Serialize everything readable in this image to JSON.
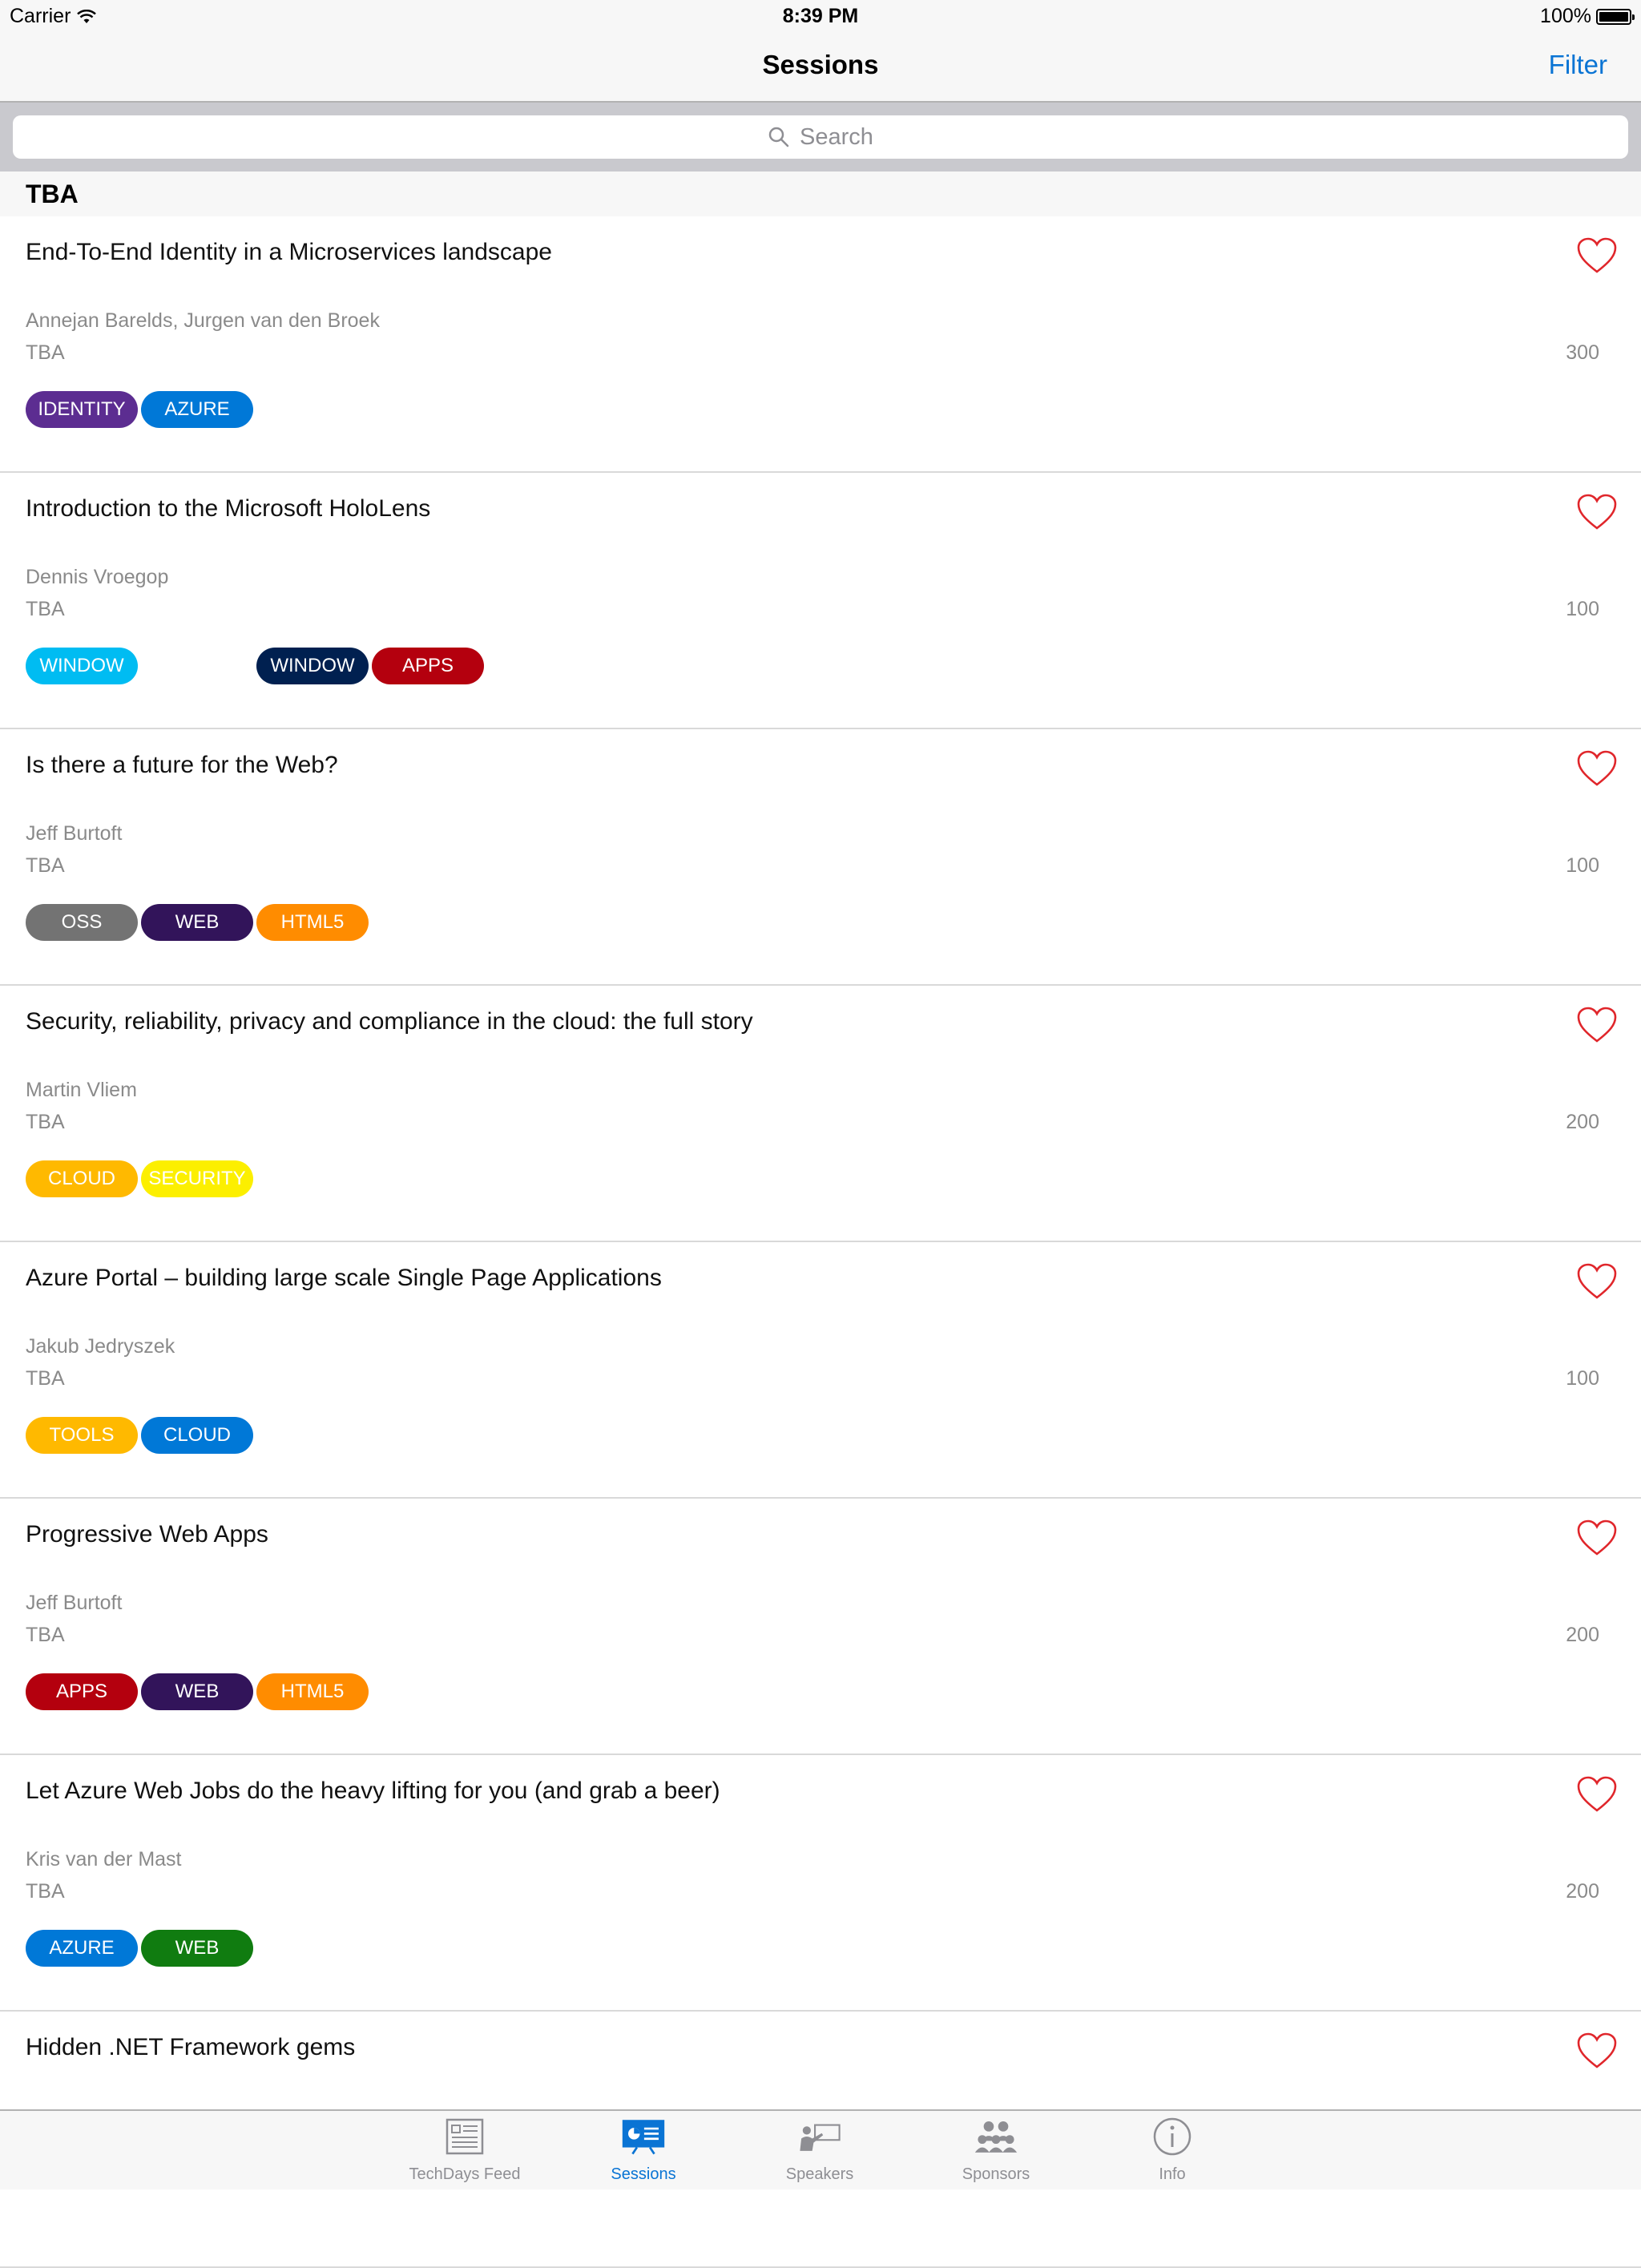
{
  "status_bar": {
    "carrier": "Carrier",
    "time": "8:39 PM",
    "battery": "100%"
  },
  "nav": {
    "title": "Sessions",
    "filter_label": "Filter"
  },
  "search": {
    "placeholder": "Search"
  },
  "section": {
    "title": "TBA"
  },
  "sessions": [
    {
      "title": "End-To-End Identity in a Microservices landscape",
      "speakers": "Annejan Barelds, Jurgen van den Broek",
      "room": "TBA",
      "level": "300",
      "tags": [
        {
          "label": "IDENTITY",
          "color": "#5c2d91"
        },
        {
          "label": "AZURE",
          "color": "#0078d7"
        }
      ]
    },
    {
      "title": "Introduction to the Microsoft HoloLens",
      "speakers": "Dennis Vroegop",
      "room": "TBA",
      "level": "100",
      "tags": [
        {
          "label": "WINDOW",
          "color": "#00bcf2"
        },
        {
          "label": "",
          "color": "transparent"
        },
        {
          "label": "WINDOW",
          "color": "#002050"
        },
        {
          "label": "APPS",
          "color": "#b4000e"
        }
      ]
    },
    {
      "title": "Is there a future for the Web?",
      "speakers": "Jeff Burtoft",
      "room": "TBA",
      "level": "100",
      "tags": [
        {
          "label": "OSS",
          "color": "#737373"
        },
        {
          "label": "WEB",
          "color": "#32145a"
        },
        {
          "label": "HTML5",
          "color": "#ff8c00"
        }
      ]
    },
    {
      "title": "Security, reliability, privacy and compliance in the cloud: the full story",
      "speakers": "Martin Vliem",
      "room": "TBA",
      "level": "200",
      "tags": [
        {
          "label": "CLOUD",
          "color": "#ffb900"
        },
        {
          "label": "SECURITY",
          "color": "#fcef00"
        }
      ]
    },
    {
      "title": "Azure Portal – building large scale Single Page Applications",
      "speakers": "Jakub Jedryszek",
      "room": "TBA",
      "level": "100",
      "tags": [
        {
          "label": "TOOLS",
          "color": "#ffb900"
        },
        {
          "label": "CLOUD",
          "color": "#0078d7"
        }
      ]
    },
    {
      "title": "Progressive Web Apps",
      "speakers": "Jeff Burtoft",
      "room": "TBA",
      "level": "200",
      "tags": [
        {
          "label": "APPS",
          "color": "#b4000e"
        },
        {
          "label": "WEB",
          "color": "#32145a"
        },
        {
          "label": "HTML5",
          "color": "#ff8c00"
        }
      ]
    },
    {
      "title": "Let Azure Web Jobs do the heavy lifting for you (and grab a beer)",
      "speakers": "Kris van der Mast",
      "room": "TBA",
      "level": "200",
      "tags": [
        {
          "label": "AZURE",
          "color": "#0078d7"
        },
        {
          "label": "WEB",
          "color": "#107c10"
        }
      ]
    },
    {
      "title": "Hidden .NET Framework gems",
      "speakers": "",
      "room": "",
      "level": "",
      "tags": []
    }
  ],
  "tabs": [
    {
      "label": "TechDays Feed",
      "icon": "newspaper-icon",
      "active": false
    },
    {
      "label": "Sessions",
      "icon": "presentation-icon",
      "active": true
    },
    {
      "label": "Speakers",
      "icon": "speaker-icon",
      "active": false
    },
    {
      "label": "Sponsors",
      "icon": "people-icon",
      "active": false
    },
    {
      "label": "Info",
      "icon": "info-icon",
      "active": false
    }
  ],
  "colors": {
    "accent": "#0a74d4",
    "heart": "#e0262b"
  }
}
